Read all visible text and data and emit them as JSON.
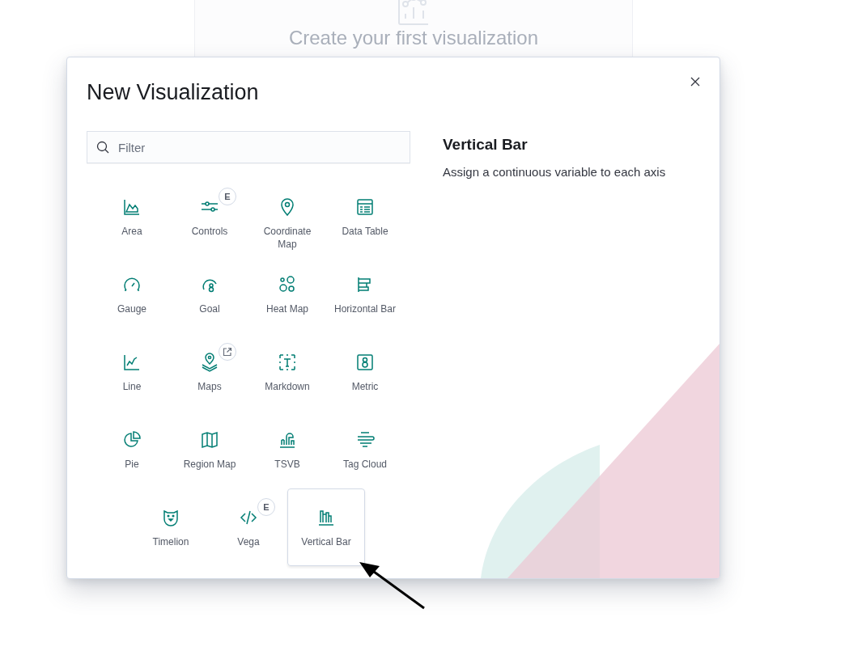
{
  "background": {
    "heading": "Create your first visualization"
  },
  "dialog": {
    "title": "New Visualization",
    "filter": {
      "placeholder": "Filter"
    },
    "types": [
      {
        "label": "Area",
        "selected": false
      },
      {
        "label": "Controls",
        "selected": false,
        "badge": {
          "kind": "text",
          "label": "E"
        }
      },
      {
        "label": "Coordinate Map",
        "selected": false
      },
      {
        "label": "Data Table",
        "selected": false
      },
      {
        "label": "Gauge",
        "selected": false
      },
      {
        "label": "Goal",
        "selected": false
      },
      {
        "label": "Heat Map",
        "selected": false
      },
      {
        "label": "Horizontal Bar",
        "selected": false
      },
      {
        "label": "Line",
        "selected": false
      },
      {
        "label": "Maps",
        "selected": false,
        "badge": {
          "kind": "external-link"
        }
      },
      {
        "label": "Markdown",
        "selected": false
      },
      {
        "label": "Metric",
        "selected": false
      },
      {
        "label": "Pie",
        "selected": false
      },
      {
        "label": "Region Map",
        "selected": false
      },
      {
        "label": "TSVB",
        "selected": false
      },
      {
        "label": "Tag Cloud",
        "selected": false
      },
      {
        "label": "Timelion",
        "selected": false
      },
      {
        "label": "Vega",
        "selected": false,
        "badge": {
          "kind": "text",
          "label": "E"
        }
      },
      {
        "label": "Vertical Bar",
        "selected": true
      }
    ],
    "description": {
      "title": "Vertical Bar",
      "text": "Assign a continuous variable to each axis"
    }
  }
}
